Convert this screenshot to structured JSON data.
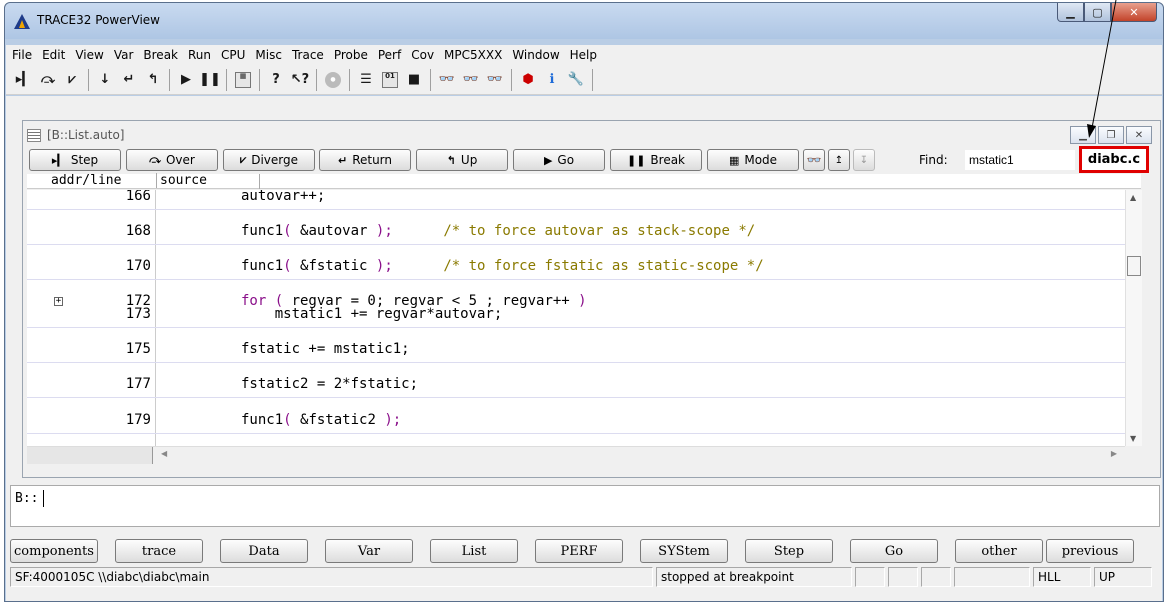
{
  "window": {
    "title": "TRACE32 PowerView"
  },
  "menu": [
    "File",
    "Edit",
    "View",
    "Var",
    "Break",
    "Run",
    "CPU",
    "Misc",
    "Trace",
    "Probe",
    "Perf",
    "Cov",
    "MPC5XXX",
    "Window",
    "Help"
  ],
  "child": {
    "title": "[B::List.auto]",
    "buttons": {
      "step": "Step",
      "over": "Over",
      "diverge": "Diverge",
      "return": "Return",
      "up": "Up",
      "go": "Go",
      "break": "Break",
      "mode": "Mode"
    },
    "find_label": "Find:",
    "find_value": "mstatic1",
    "file_label": "diabc.c",
    "columns": {
      "addr": "addr/line",
      "source": "source"
    },
    "rows": [
      {
        "line": "166",
        "parts": [
          {
            "t": "autovar++;",
            "c": ""
          }
        ]
      },
      {
        "line": "168",
        "parts": [
          {
            "t": "func1",
            "c": ""
          },
          {
            "t": "(",
            "c": "kw"
          },
          {
            "t": " &autovar ",
            "c": ""
          },
          {
            "t": ");",
            "c": "kw"
          },
          {
            "t": "      ",
            "c": ""
          },
          {
            "t": "/* to force autovar as stack-scope */",
            "c": "cm"
          }
        ]
      },
      {
        "line": "170",
        "parts": [
          {
            "t": "func1",
            "c": ""
          },
          {
            "t": "(",
            "c": "kw"
          },
          {
            "t": " &fstatic ",
            "c": ""
          },
          {
            "t": ");",
            "c": "kw"
          },
          {
            "t": "      ",
            "c": ""
          },
          {
            "t": "/* to force fstatic as static-scope */",
            "c": "cm"
          }
        ]
      },
      {
        "line": "172",
        "parts": [
          {
            "t": "for ( ",
            "c": "kw"
          },
          {
            "t": "regvar = 0; regvar < 5 ; regvar++ ",
            "c": ""
          },
          {
            "t": ")",
            "c": "kw"
          }
        ]
      },
      {
        "line": "173",
        "parts": [
          {
            "t": "    mstatic1 += regvar*autovar;",
            "c": ""
          }
        ]
      },
      {
        "line": "175",
        "parts": [
          {
            "t": "fstatic += mstatic1;",
            "c": ""
          }
        ]
      },
      {
        "line": "177",
        "parts": [
          {
            "t": "fstatic2 = 2*fstatic;",
            "c": ""
          }
        ]
      },
      {
        "line": "179",
        "parts": [
          {
            "t": "func1",
            "c": ""
          },
          {
            "t": "(",
            "c": "kw"
          },
          {
            "t": " &fstatic2 ",
            "c": ""
          },
          {
            "t": ");",
            "c": "kw"
          }
        ]
      }
    ]
  },
  "command": {
    "prompt": "B::"
  },
  "softkeys": [
    "components",
    "trace",
    "Data",
    "Var",
    "List",
    "PERF",
    "SYStem",
    "Step",
    "Go",
    "other",
    "previous"
  ],
  "status": {
    "location": "SF:4000105C  \\\\diabc\\diabc\\main",
    "state": "stopped at breakpoint",
    "mode1": "HLL",
    "mode2": "UP"
  },
  "colors": {
    "highlight_box": "#e00000",
    "keyword": "#8a0f8a",
    "comment": "#8a7a00"
  }
}
